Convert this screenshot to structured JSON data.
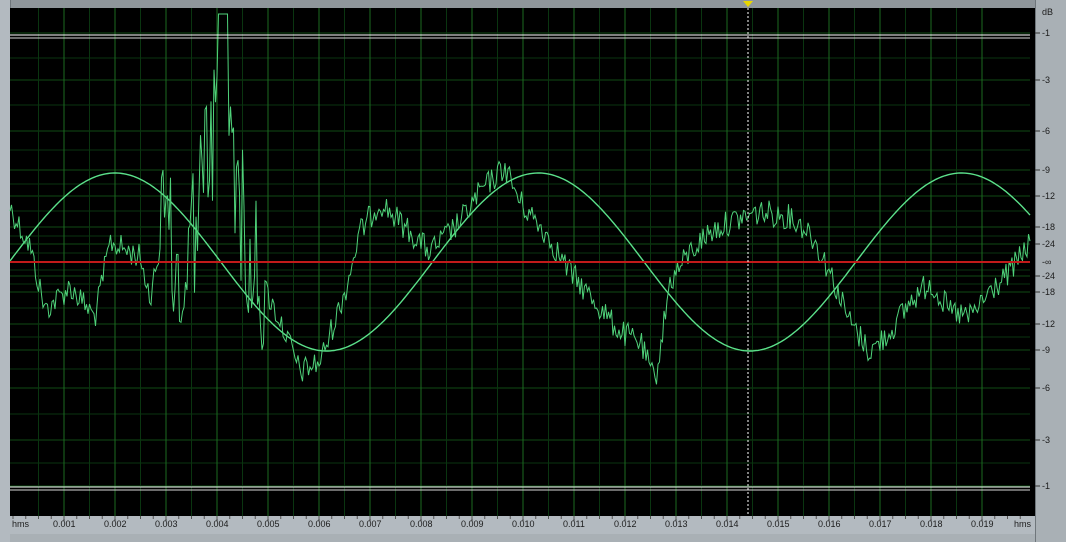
{
  "window": {
    "title": ""
  },
  "colors": {
    "background": "#000000",
    "grid": "#0f4a14",
    "grid_major": "#1c6a20",
    "waveform_sine": "#5be08a",
    "waveform_noise": "#4fd27a",
    "center_line": "#c21a1a",
    "clip_lines": "#ffffff",
    "cursor": "#ffffff",
    "ruler": "#b3bac0"
  },
  "db_ruler": {
    "unit": "dB",
    "top_labels": [
      "-1",
      "-3",
      "-6",
      "-9",
      "-12",
      "-18",
      "-24"
    ],
    "center_label": "-∞",
    "bottom_labels": [
      "-24",
      "-18",
      "-12",
      "-9",
      "-6",
      "-3",
      "-1"
    ]
  },
  "time_ruler": {
    "unit_left": "hms",
    "unit_right": "hms",
    "labels": [
      "0.001",
      "0.002",
      "0.003",
      "0.004",
      "0.005",
      "0.006",
      "0.007",
      "0.008",
      "0.009",
      "0.010",
      "0.011",
      "0.012",
      "0.013",
      "0.014",
      "0.015",
      "0.016",
      "0.017",
      "0.018",
      "0.019"
    ]
  },
  "icons": {
    "playhead_top": "triangle-down-icon",
    "playhead_bottom": "triangle-up-icon"
  },
  "chart_data": {
    "type": "line",
    "xlabel": "hms",
    "ylabel": "dB",
    "xlim": [
      0,
      0.02
    ],
    "series": [
      {
        "kind": "sine",
        "period": 0.0083,
        "peak_time": 0.002,
        "amplitude_db": -9
      },
      {
        "kind": "noisy-signal",
        "peak_time": 0.0042,
        "peak_db": -1
      }
    ],
    "cursor_time": 0.0145,
    "clip_level_db": -1
  }
}
